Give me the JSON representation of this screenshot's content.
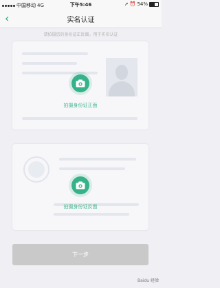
{
  "status_bar": {
    "carrier": "中国移动",
    "network": "4G",
    "time": "下午5:46",
    "battery": "54%"
  },
  "nav": {
    "back_icon": "chevron-left-icon",
    "title": "实名认证"
  },
  "hint": "请拍摄您的身份证正反面，用于实名认证",
  "cards": {
    "front_label": "拍摄身份证正面",
    "back_label": "拍摄身份证反面"
  },
  "next_button": "下一步",
  "watermark": "Baidu 经验",
  "colors": {
    "accent": "#36b28a",
    "accent_text": "#47b68f",
    "button_disabled": "#c9c9c9",
    "background": "#efeff4"
  }
}
